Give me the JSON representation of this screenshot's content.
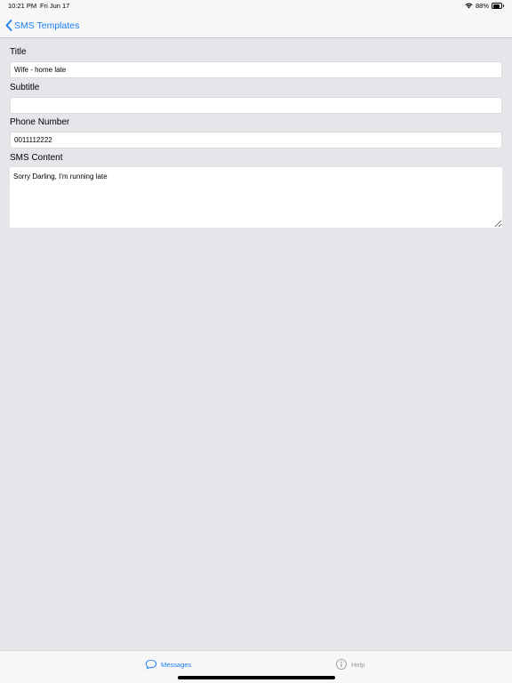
{
  "status_bar": {
    "time": "10:21 PM",
    "date": "Fri Jun 17",
    "battery": "88%",
    "battery_level": 0.88,
    "icons": [
      "wifi-icon",
      "battery-icon"
    ]
  },
  "nav": {
    "back_label": "SMS Templates",
    "back_icon": "chevron-left-icon"
  },
  "form": {
    "title": {
      "label": "Title",
      "value": "Wife - home late"
    },
    "subtitle": {
      "label": "Subtitle",
      "value": ""
    },
    "phone": {
      "label": "Phone Number",
      "value": "0011112222"
    },
    "content": {
      "label": "SMS Content",
      "value": "Sorry Darling, I'm running late"
    }
  },
  "tabs": [
    {
      "label": "Messages",
      "icon": "chat-bubble-icon",
      "selected": true
    },
    {
      "label": "Help",
      "icon": "info-icon",
      "selected": false
    }
  ],
  "colors": {
    "accent": "#1a7ef5",
    "background": "#e6e5ea",
    "inactive_tab": "#9a9a9e"
  }
}
